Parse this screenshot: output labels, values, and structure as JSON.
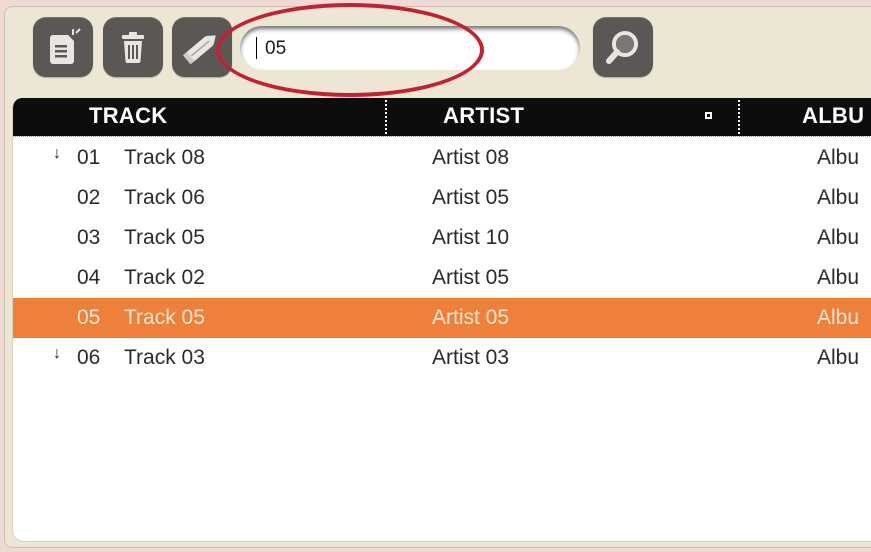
{
  "toolbar": {
    "new_icon": "new-document-icon",
    "delete_icon": "trash-icon",
    "edit_icon": "pencil-icon",
    "search_icon": "magnifier-icon"
  },
  "search": {
    "value": "05"
  },
  "columns": {
    "track": "TRACK",
    "artist": "ARTIST",
    "album": "ALBU"
  },
  "rows": [
    {
      "arrow": "↓",
      "num": "01",
      "title": "Track 08",
      "artist": "Artist 08",
      "album": "Albu"
    },
    {
      "arrow": "",
      "num": "02",
      "title": "Track 06",
      "artist": "Artist 05",
      "album": "Albu"
    },
    {
      "arrow": "",
      "num": "03",
      "title": "Track 05",
      "artist": "Artist 10",
      "album": "Albu"
    },
    {
      "arrow": "",
      "num": "04",
      "title": "Track 02",
      "artist": "Artist 05",
      "album": "Albu"
    },
    {
      "arrow": "",
      "num": "05",
      "title": "Track 05",
      "artist": "Artist 05",
      "album": "Albu"
    },
    {
      "arrow": "↓",
      "num": "06",
      "title": "Track 03",
      "artist": "Artist 03",
      "album": "Albu"
    }
  ],
  "selected_row": 4,
  "colors": {
    "selection": "#ee803a",
    "highlight_ring": "#c51f33",
    "header_bg": "#0d0d0d",
    "button_bg": "#5a5754"
  }
}
